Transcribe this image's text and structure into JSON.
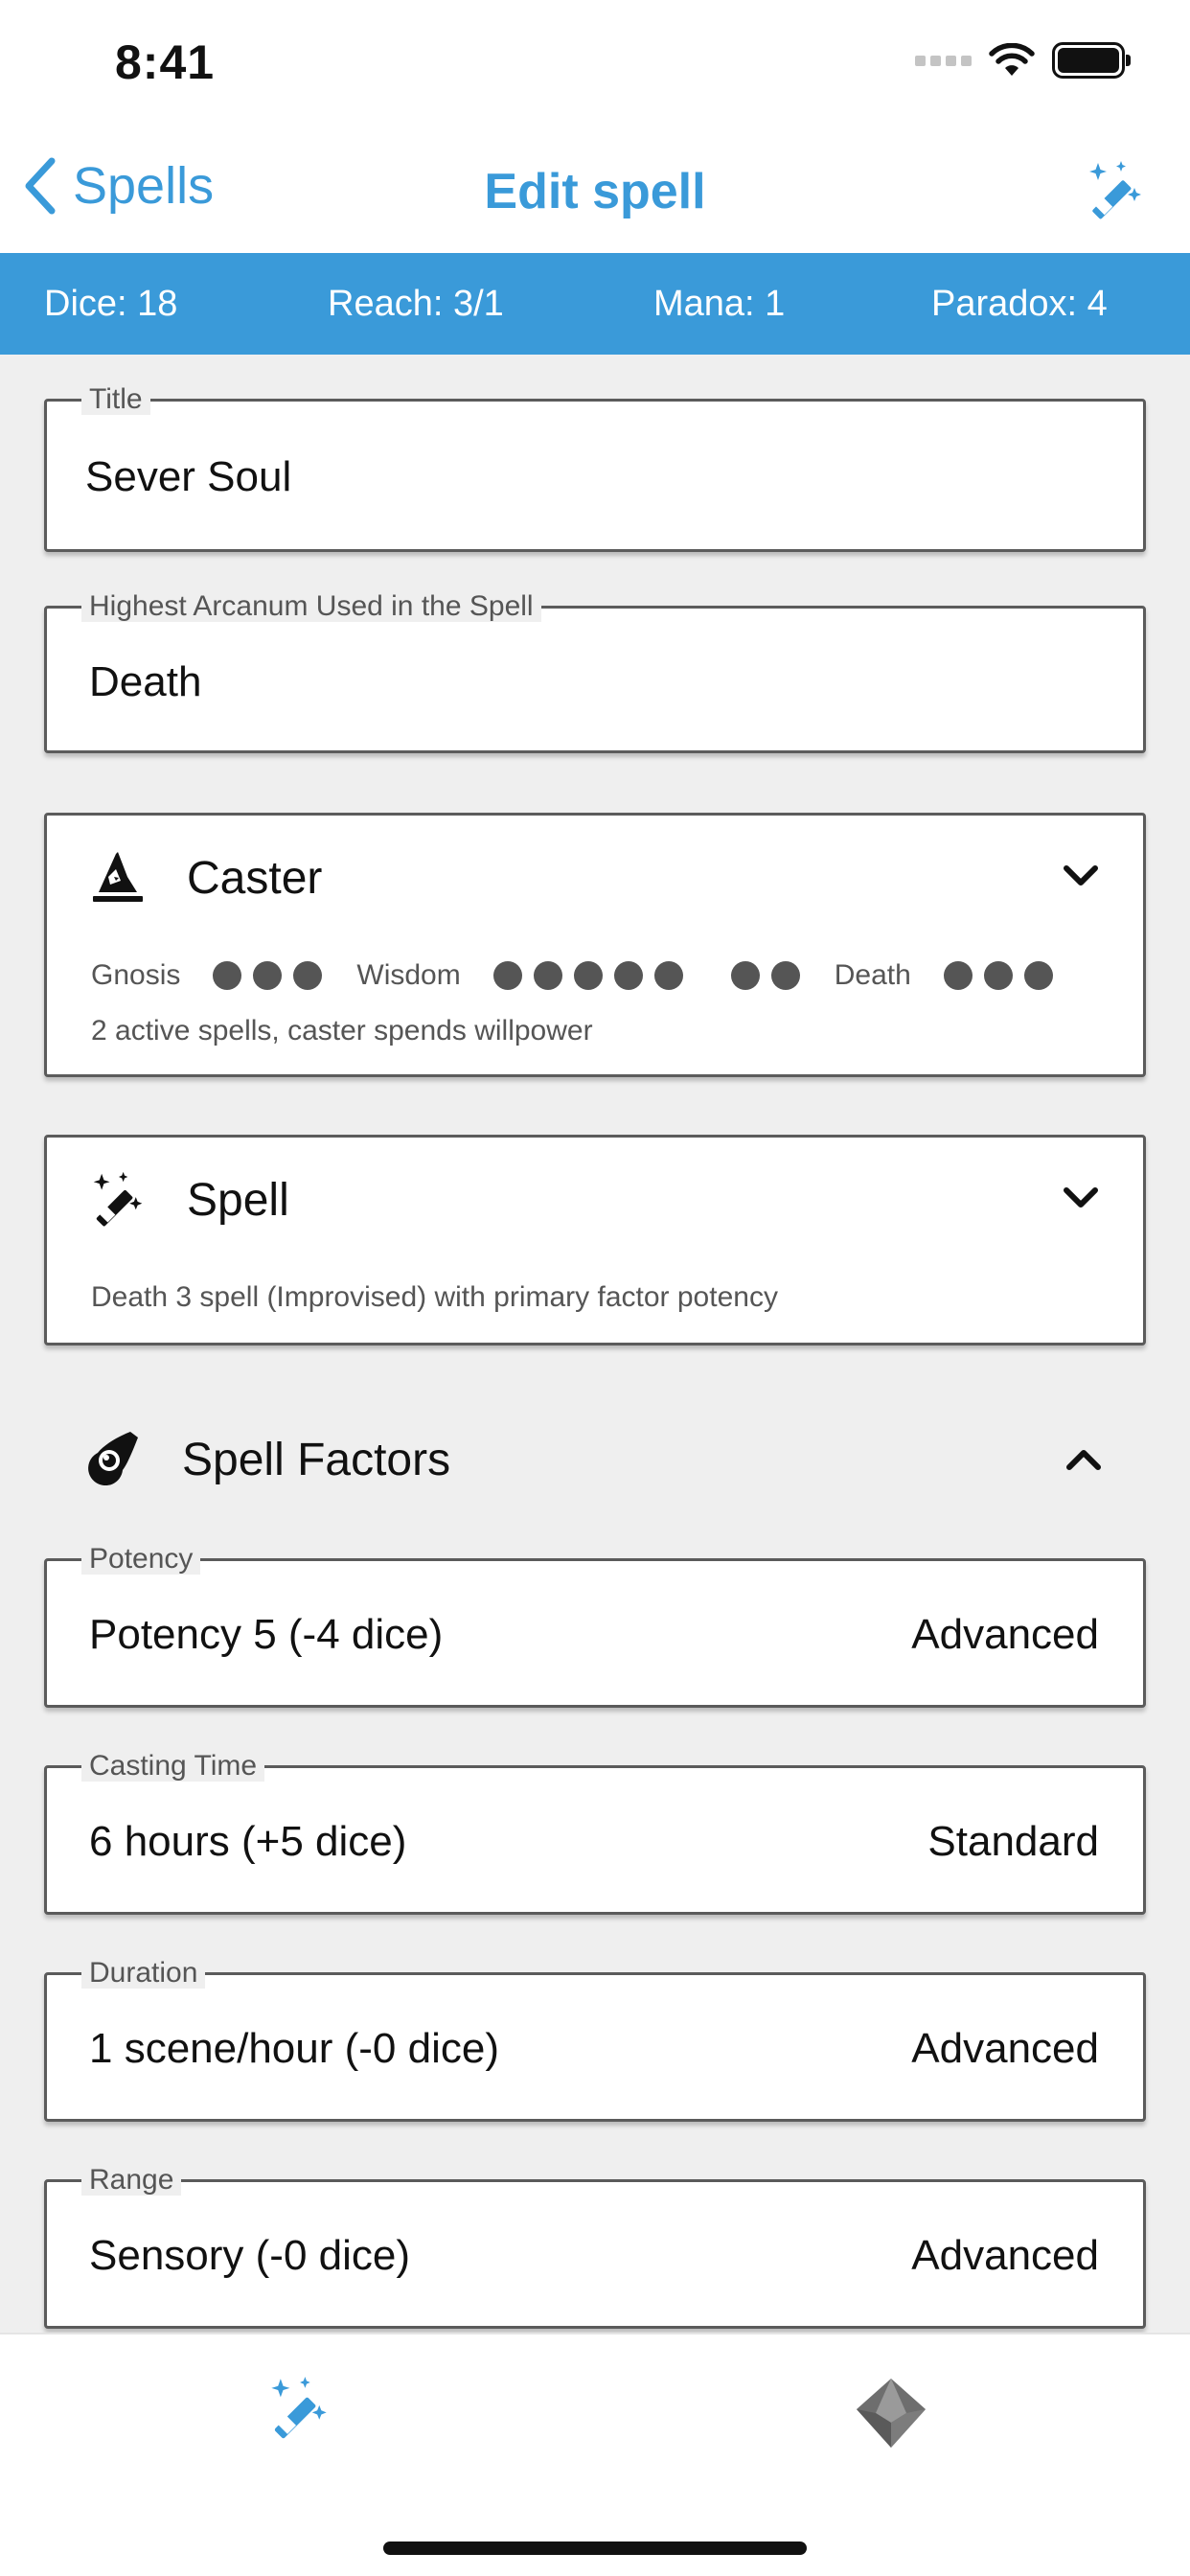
{
  "status": {
    "time": "8:41"
  },
  "nav": {
    "back_label": "Spells",
    "title": "Edit spell",
    "action_icon": "magic-wand-icon"
  },
  "stats": {
    "dice": "Dice: 18",
    "reach": "Reach: 3/1",
    "mana": "Mana: 1",
    "paradox": "Paradox: 4"
  },
  "title_field": {
    "label": "Title",
    "value": "Sever Soul"
  },
  "arcanum_field": {
    "label": "Highest Arcanum Used in the Spell",
    "value": "Death"
  },
  "caster": {
    "title": "Caster",
    "gnosis_label": "Gnosis",
    "gnosis": 3,
    "wisdom_label": "Wisdom",
    "wisdom": 7,
    "death_label": "Death",
    "death": 3,
    "summary": "2 active spells, caster spends willpower"
  },
  "spell": {
    "title": "Spell",
    "summary": "Death 3 spell (Improvised) with primary factor potency"
  },
  "factors": {
    "title": "Spell Factors",
    "potency": {
      "label": "Potency",
      "value": "Potency 5 (-4 dice)",
      "mode": "Advanced"
    },
    "casting_time": {
      "label": "Casting Time",
      "value": "6 hours (+5 dice)",
      "mode": "Standard"
    },
    "duration": {
      "label": "Duration",
      "value": "1 scene/hour (-0 dice)",
      "mode": "Advanced"
    },
    "range": {
      "label": "Range",
      "value": "Sensory (-0 dice)",
      "mode": "Advanced"
    }
  },
  "tabs": [
    {
      "icon": "magic-wand-icon",
      "active": true
    },
    {
      "icon": "dice-icon",
      "active": false
    }
  ],
  "colors": {
    "accent": "#3a9ad9",
    "background": "#efefef",
    "border": "#5b5b5b"
  }
}
